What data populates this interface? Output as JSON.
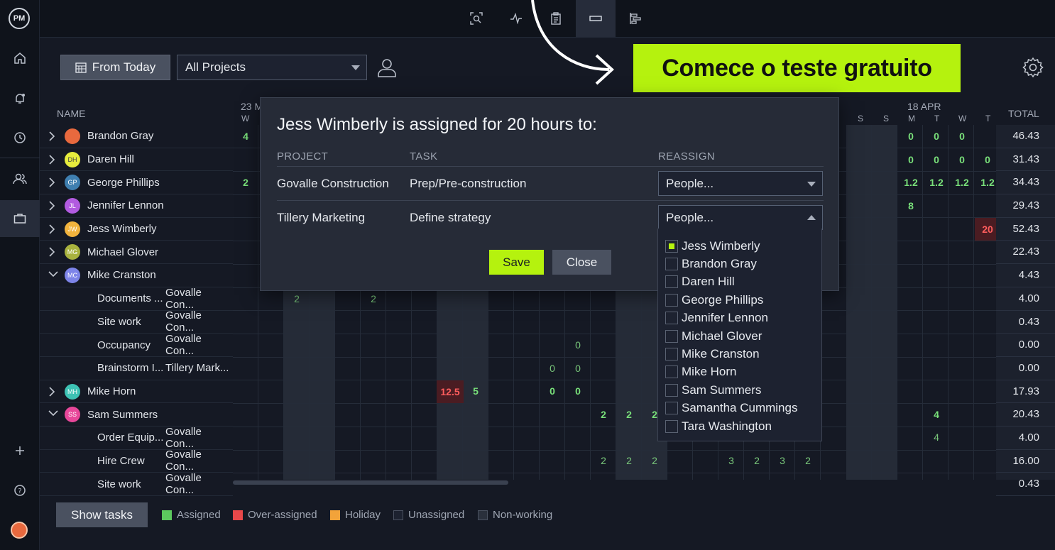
{
  "rail": {
    "logo": "PM",
    "icons": [
      "home-icon",
      "notifications-icon",
      "clock-icon",
      "people-icon",
      "briefcase-icon",
      "plus-icon",
      "help-icon"
    ]
  },
  "toolbar": {
    "views": [
      "search-zoom-icon",
      "pulse-icon",
      "clipboard-icon",
      "workload-icon",
      "gantt-icon"
    ]
  },
  "controls": {
    "from_today": "From Today",
    "project_filter": "All Projects"
  },
  "cta": {
    "label": "Comece o teste gratuito"
  },
  "grid": {
    "name_header": "NAME",
    "total_header": "TOTAL",
    "date_left": "23 M",
    "date_left_day": "W",
    "date_right": "18 APR",
    "days_right": [
      "S",
      "S",
      "M",
      "T",
      "W",
      "T"
    ],
    "rows": [
      {
        "label": "Brandon Gray",
        "initials": "",
        "total": "46.43"
      },
      {
        "label": "Daren Hill",
        "initials": "DH",
        "total": "31.43"
      },
      {
        "label": "George Phillips",
        "initials": "GP",
        "total": "34.43"
      },
      {
        "label": "Jennifer Lennon",
        "initials": "JL",
        "total": "29.43"
      },
      {
        "label": "Jess Wimberly",
        "initials": "JW",
        "total": "52.43"
      },
      {
        "label": "Michael Glover",
        "initials": "MG",
        "total": "22.43"
      },
      {
        "label": "Mike Cranston",
        "initials": "MC",
        "total": "4.43"
      },
      {
        "task": "Documents ...",
        "project": "Govalle Con...",
        "total": "4.00"
      },
      {
        "task": "Site work",
        "project": "Govalle Con...",
        "total": "0.43"
      },
      {
        "task": "Occupancy",
        "project": "Govalle Con...",
        "total": "0.00"
      },
      {
        "task": "Brainstorm I...",
        "project": "Tillery Mark...",
        "total": "0.00"
      },
      {
        "label": "Mike Horn",
        "initials": "MH",
        "total": "17.93"
      },
      {
        "label": "Sam Summers",
        "initials": "SS",
        "total": "20.43"
      },
      {
        "task": "Order Equip...",
        "project": "Govalle Con...",
        "total": "4.00"
      },
      {
        "task": "Hire Crew",
        "project": "Govalle Con...",
        "total": "16.00"
      },
      {
        "task": "Site work",
        "project": "Govalle Con...",
        "total": "0.43"
      }
    ],
    "cell_values": {
      "r0_left": "4",
      "r2_left": "2",
      "r0_right": [
        "0",
        "0",
        "0"
      ],
      "r1_right": [
        "0",
        "0",
        "0",
        "0"
      ],
      "r2_right": [
        "1.2",
        "1.2",
        "1.2",
        "1.2"
      ],
      "r3_right": "8",
      "r4_right": "20",
      "r7": [
        "2",
        "2"
      ],
      "r9": "0",
      "r10": [
        "0",
        "0"
      ],
      "r11": [
        "12.5",
        "5",
        "0",
        "0"
      ],
      "r12": [
        "2",
        "2",
        "2",
        "4"
      ],
      "r13": "4",
      "r14": [
        "2",
        "2",
        "2",
        "3",
        "2",
        "3",
        "2"
      ]
    }
  },
  "footer": {
    "show_tasks": "Show tasks",
    "legend": [
      {
        "label": "Assigned",
        "color": "#5cc95e"
      },
      {
        "label": "Over-assigned",
        "color": "#e8484a"
      },
      {
        "label": "Holiday",
        "color": "#f2a33a"
      },
      {
        "label": "Unassigned",
        "color": "#1d2230"
      },
      {
        "label": "Non-working",
        "color": "#2a303c"
      }
    ]
  },
  "modal": {
    "title": "Jess Wimberly is assigned for 20 hours to:",
    "col_project": "PROJECT",
    "col_task": "TASK",
    "col_reassign": "REASSIGN",
    "rows": [
      {
        "project": "Govalle Construction",
        "task": "Prep/Pre-construction",
        "reassign": "People..."
      },
      {
        "project": "Tillery Marketing",
        "task": "Define strategy",
        "reassign": "People..."
      }
    ],
    "save": "Save",
    "close": "Close",
    "people": [
      {
        "name": "Jess Wimberly",
        "checked": true
      },
      {
        "name": "Brandon Gray",
        "checked": false
      },
      {
        "name": "Daren Hill",
        "checked": false
      },
      {
        "name": "George Phillips",
        "checked": false
      },
      {
        "name": "Jennifer Lennon",
        "checked": false
      },
      {
        "name": "Michael Glover",
        "checked": false
      },
      {
        "name": "Mike Cranston",
        "checked": false
      },
      {
        "name": "Mike Horn",
        "checked": false
      },
      {
        "name": "Sam Summers",
        "checked": false
      },
      {
        "name": "Samantha Cummings",
        "checked": false
      },
      {
        "name": "Tara Washington",
        "checked": false
      }
    ]
  }
}
